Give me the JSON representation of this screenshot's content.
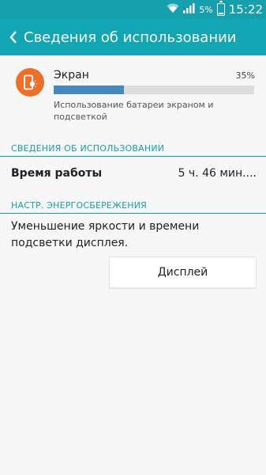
{
  "status_bar": {
    "battery_percent": "5%",
    "time": "15:22",
    "icons": [
      "wifi-icon",
      "signal-icon",
      "battery-icon"
    ]
  },
  "app_bar": {
    "title": "Сведения об использовании",
    "back_icon": "chevron-left-icon"
  },
  "usage": {
    "icon": "screen-brightness-icon",
    "icon_color": "#ec6f2a",
    "name": "Экран",
    "percent_label": "35%",
    "percent_value": 0.35,
    "bar_color": "#4788bd",
    "description": "Использование батареи экраном и подсветкой"
  },
  "details": {
    "header": "СВЕДЕНИЯ ОБ ИСПОЛЬЗОВАНИИ",
    "runtime_label": "Время работы",
    "runtime_value": "5 ч. 46 мин...."
  },
  "power_saving": {
    "header": "НАСТР. ЭНЕРГОСБЕРЕЖЕНИЯ",
    "text": "Уменьшение яркости и времени подсветки дисплея.",
    "button_label": "Дисплей"
  },
  "colors": {
    "accent": "#12a5b3",
    "status_bar": "#16a0ad"
  }
}
